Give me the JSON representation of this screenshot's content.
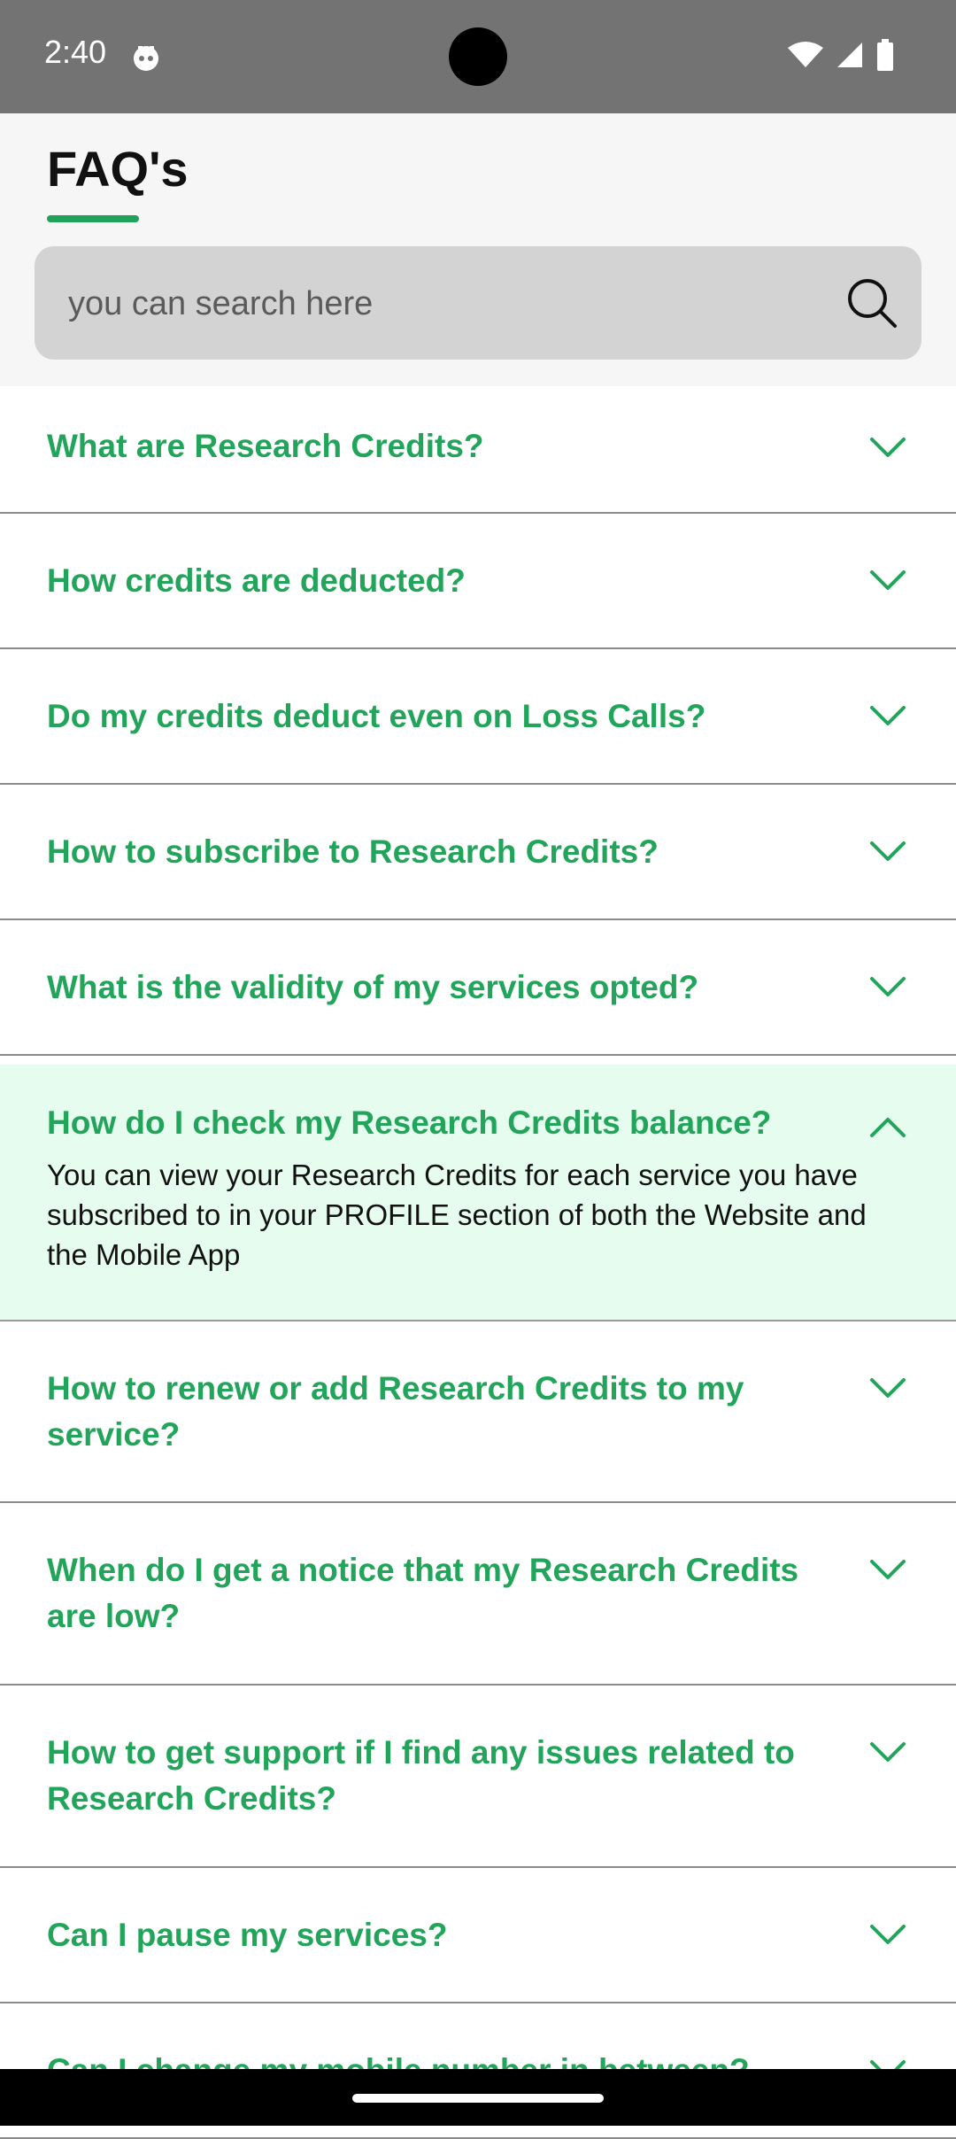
{
  "status_bar": {
    "time": "2:40"
  },
  "header": {
    "title": "FAQ's",
    "search_placeholder": "you can search here"
  },
  "faqs": [
    {
      "question": "What are Research Credits?",
      "expanded": false
    },
    {
      "question": "How credits are deducted?",
      "expanded": false
    },
    {
      "question": "Do my credits deduct even on Loss Calls?",
      "expanded": false
    },
    {
      "question": "How to subscribe to Research Credits?",
      "expanded": false
    },
    {
      "question": "What is the validity of my services opted?",
      "expanded": false
    },
    {
      "question": "How do I check my Research Credits balance?",
      "expanded": true,
      "answer": "You can view your Research Credits for each service you have subscribed to in your PROFILE section of both the Website and the Mobile App"
    },
    {
      "question": "How to renew or add Research Credits to my service?",
      "expanded": false
    },
    {
      "question": "When do I get a notice that my Research Credits are low?",
      "expanded": false
    },
    {
      "question": "How to get support if I find any issues related to Research Credits?",
      "expanded": false
    },
    {
      "question": "Can I pause my services?",
      "expanded": false
    },
    {
      "question": "Can I change my mobile number in between?",
      "expanded": false
    }
  ],
  "colors": {
    "accent": "#22a55b",
    "expanded_bg": "#e6fcef"
  }
}
